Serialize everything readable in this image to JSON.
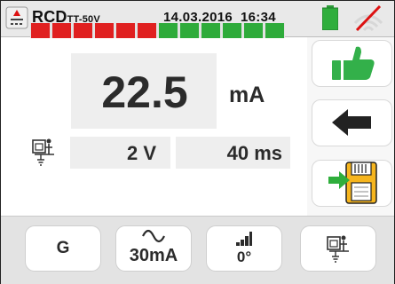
{
  "header": {
    "title": "RCD",
    "subtitle": "TT-50V",
    "date": "14.03.2016",
    "time": "16:34",
    "icons": [
      "rcd-symbol-icon",
      "battery-icon",
      "no-signal-icon"
    ]
  },
  "measurement": {
    "value": "22.5",
    "unit": "mA",
    "voltage": "2 V",
    "trip_time": "40 ms",
    "bar_segments": 12,
    "bar_red_segments": 6,
    "bar_green_segments": 6,
    "colors": {
      "red": "#e02020",
      "green": "#2eab3a",
      "track": "#e2e2e2"
    }
  },
  "buttons": {
    "right": [
      "thumbs-up-icon",
      "back-arrow-icon",
      "save-icon"
    ],
    "bottom": {
      "mode": "G",
      "current": "30mA",
      "phase": "0°"
    }
  }
}
